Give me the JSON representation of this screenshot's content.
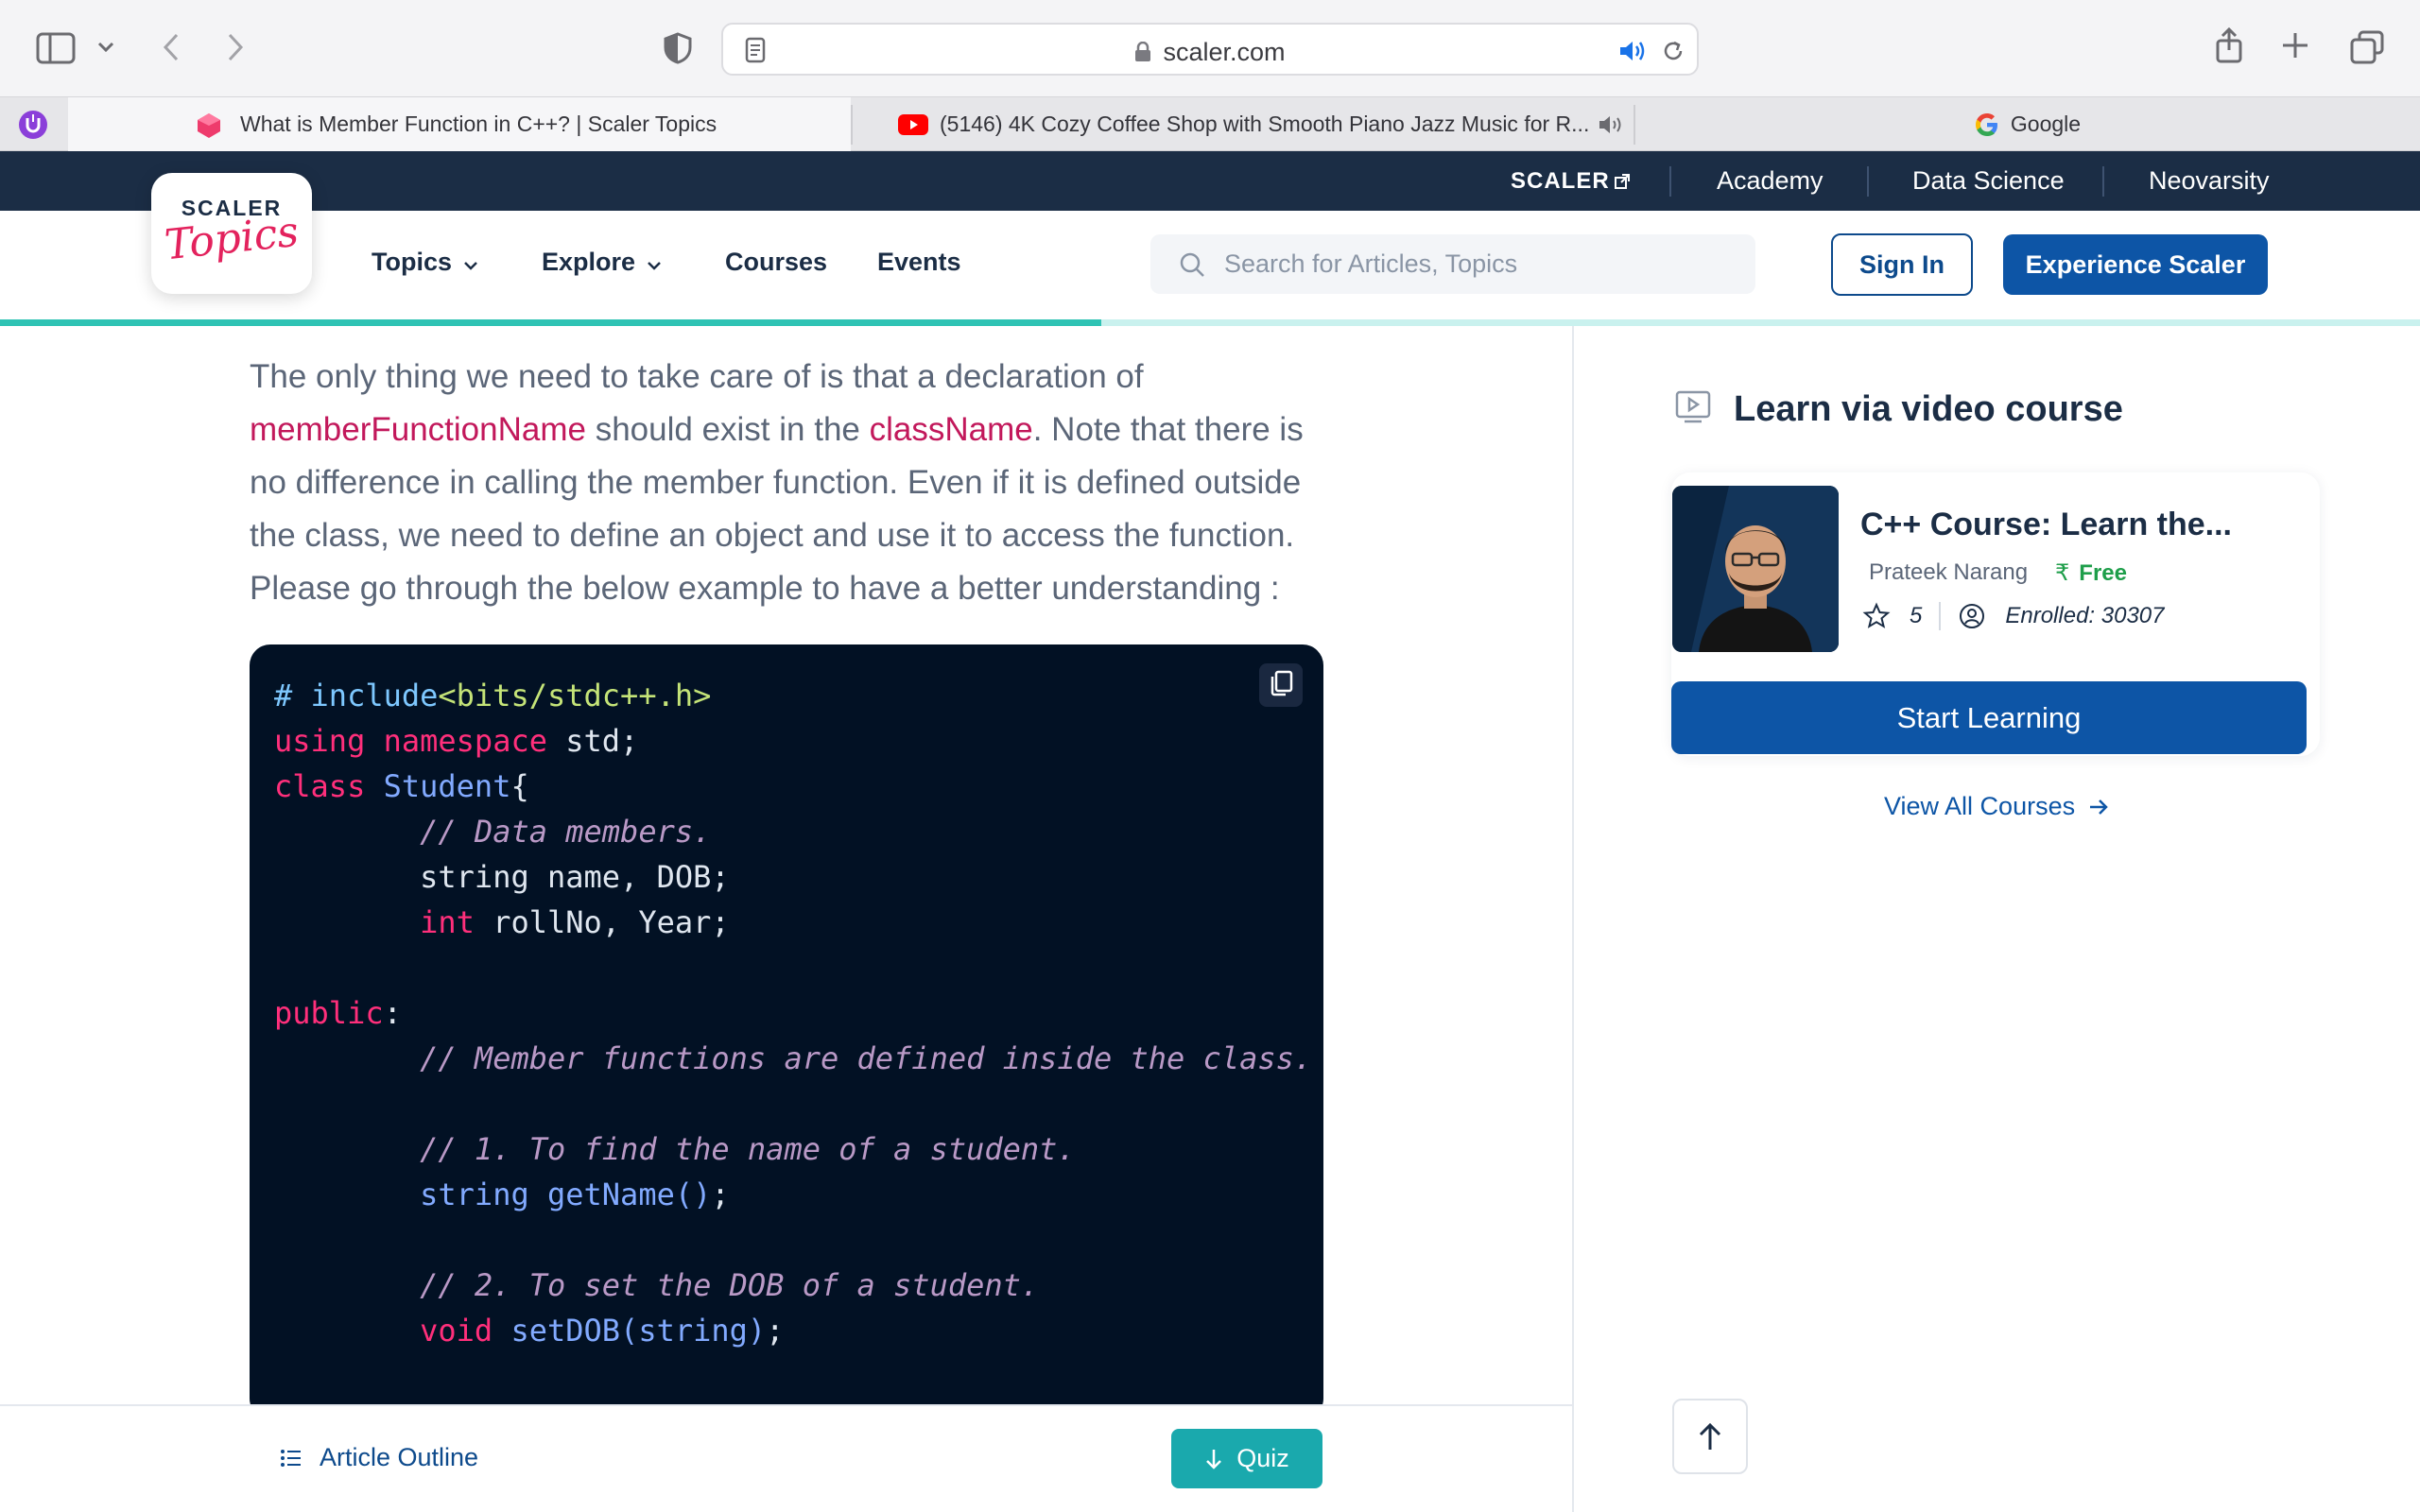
{
  "browser": {
    "url": "scaler.com",
    "tabs": [
      {
        "title": "What is Member Function in C++? | Scaler Topics",
        "active": true
      },
      {
        "title": "(5146) 4K Cozy Coffee Shop with Smooth Piano Jazz Music for R...",
        "active": false
      },
      {
        "title": "Google",
        "active": false
      }
    ]
  },
  "site": {
    "strip_brand": "SCALER",
    "strip_items": [
      "Academy",
      "Data Science",
      "Neovarsity"
    ],
    "logo_top": "SCALER",
    "logo_script": "Topics",
    "nav": [
      "Topics",
      "Explore",
      "Courses",
      "Events"
    ],
    "search_placeholder": "Search for Articles, Topics",
    "signin": "Sign In",
    "experience": "Experience Scaler",
    "progress": 0.455
  },
  "article": {
    "p1": "The only thing we need to take care of is that a declaration of",
    "ref1": "memberFunctionName",
    "p2": "should exist in the",
    "ref2": "className",
    "p3": ". Note that there is no difference in calling the member function. Even if it is defined outside the class, we need to define an object and use it to access the function. Please go through the below example to have a better understanding :",
    "code": {
      "l1_pre": "# include",
      "l1_inc": "<bits/stdc++.h>",
      "l2_kw1": "using",
      "l2_kw2": "namespace",
      "l2_rest": " std;",
      "l3_kw": "class",
      "l3_cls": "Student",
      "l3_rest": "{",
      "l4": "// Data members.",
      "l5": "string name, DOB;",
      "l6_kw": "int",
      "l6_rest": " rollNo, Year;",
      "l8_kw": "public",
      "l8_rest": ":",
      "l9": "// Member functions are defined inside the class.",
      "l11": "// 1. To find the name of a student.",
      "l12_type": "string",
      "l12_fn": "getName()",
      "l12_rest": ";",
      "l14": "// 2. To set the DOB of a student.",
      "l15_kw": "void",
      "l15_fn": "setDOB(string)",
      "l15_rest": ";"
    }
  },
  "sidebar": {
    "title": "Learn via video course",
    "course_title": "C++ Course: Learn the...",
    "instructor": "Prateek Narang",
    "price": "Free",
    "rating": "5",
    "enrolled": "Enrolled: 30307",
    "start": "Start Learning",
    "view_all": "View All Courses"
  },
  "bottom": {
    "outline": "Article Outline",
    "quiz": "Quiz"
  },
  "colors": {
    "navy": "#1b2d45",
    "brand_blue": "#0d55a6",
    "teal": "#2fc3b4",
    "code_bg": "#021124",
    "ref_pink": "#c2185b"
  }
}
